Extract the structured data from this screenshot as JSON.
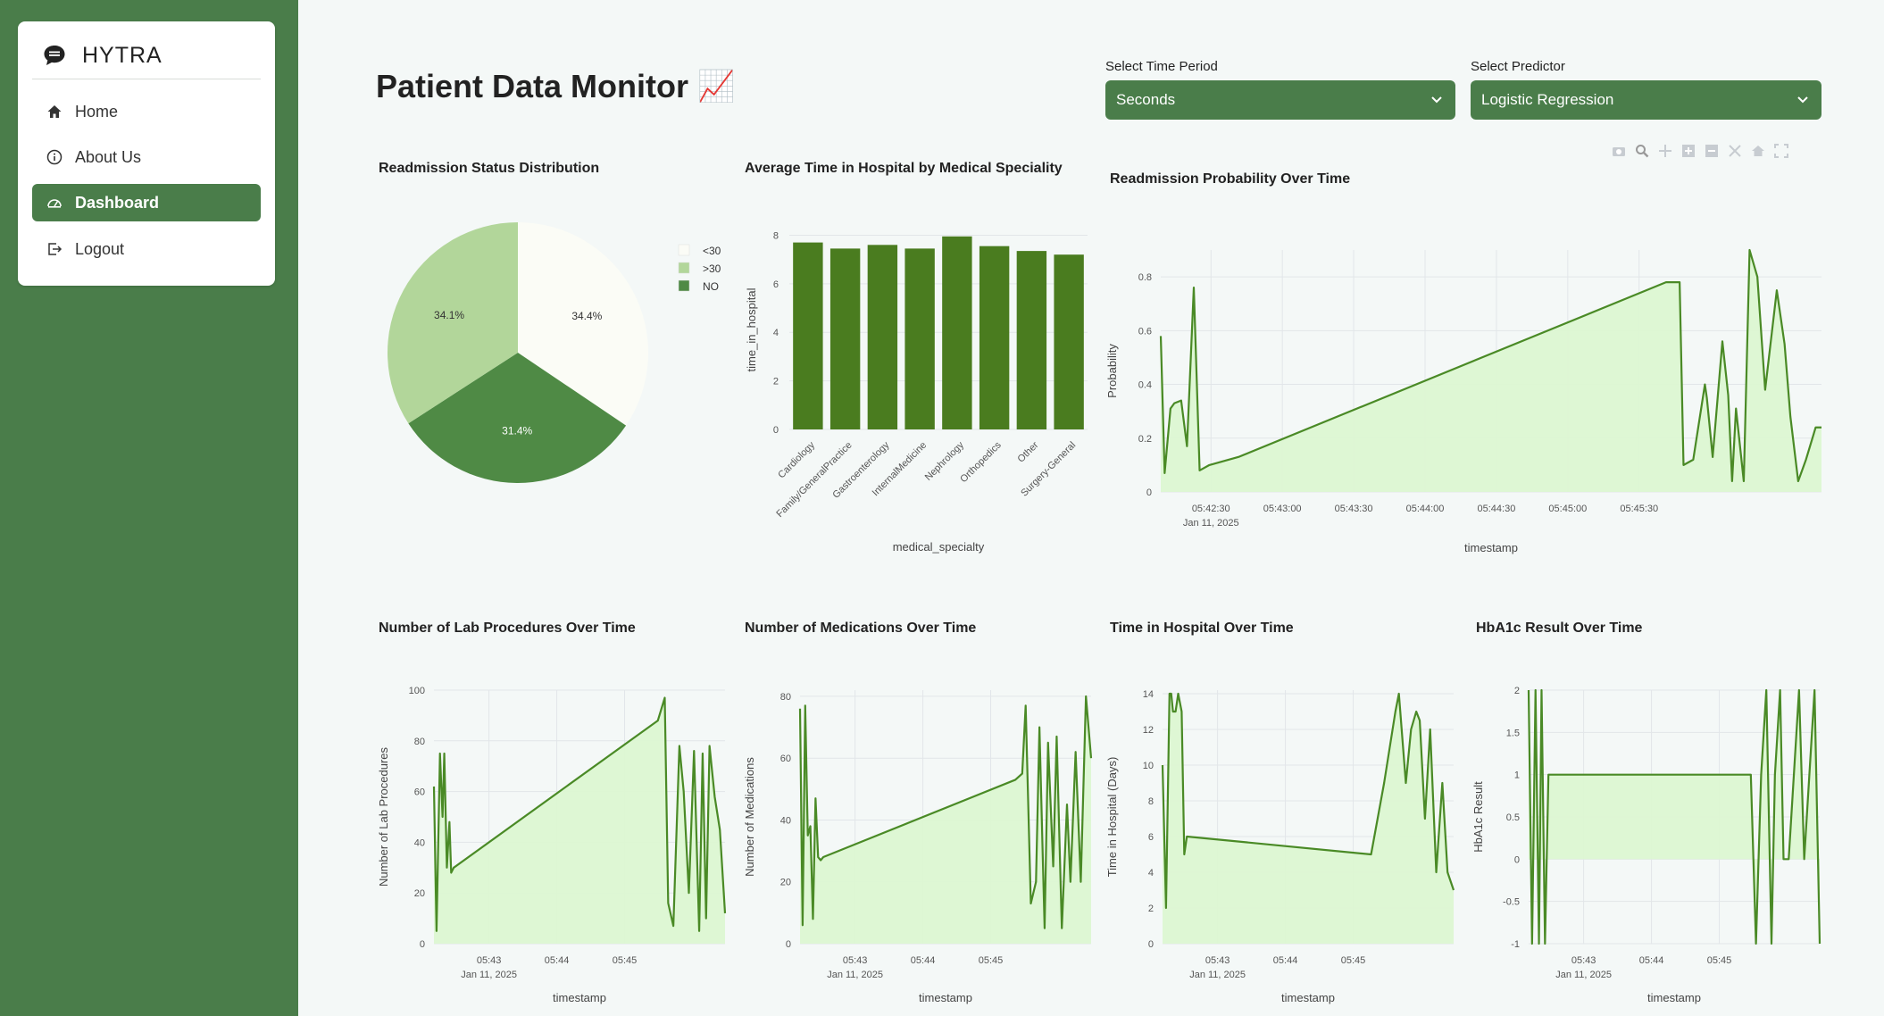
{
  "app": {
    "brand": "HYTRA"
  },
  "nav": {
    "items": [
      {
        "label": "Home",
        "icon": "home-icon"
      },
      {
        "label": "About Us",
        "icon": "info-icon"
      },
      {
        "label": "Dashboard",
        "icon": "dashboard-gauge-icon",
        "active": true
      },
      {
        "label": "Logout",
        "icon": "logout-icon"
      }
    ]
  },
  "page": {
    "title": "Patient Data Monitor",
    "title_emoji": "📈"
  },
  "controls": {
    "time_period": {
      "label": "Select Time Period",
      "value": "Seconds"
    },
    "predictor": {
      "label": "Select Predictor",
      "value": "Logistic Regression"
    }
  },
  "colors": {
    "accent": "#4a7d4a",
    "bar": "#4a7c1f",
    "line": "#4a8a26",
    "fill": "#dcf7d2",
    "pie_light": "#fbfcf6",
    "pie_mid": "#b2d69a",
    "pie_dark": "#4f8a45"
  },
  "modebar_icons": [
    "camera-icon",
    "zoom-icon",
    "pan-icon",
    "zoom-in-icon",
    "zoom-out-icon",
    "autoscale-icon",
    "reset-home-icon",
    "fullscreen-icon"
  ],
  "chart_data": [
    {
      "id": "pie",
      "type": "pie",
      "title": "Readmission Status Distribution",
      "legend": [
        "<30",
        ">30",
        "NO"
      ],
      "slices": [
        {
          "label": "<30",
          "value": 34.4,
          "text": "34.4%"
        },
        {
          "label": "NO",
          "value": 31.4,
          "text": "31.4%"
        },
        {
          "label": ">30",
          "value": 34.1,
          "text": "34.1%"
        }
      ],
      "legend_position": "right"
    },
    {
      "id": "bar",
      "type": "bar",
      "title": "Average Time in Hospital by Medical Speciality",
      "xlabel": "medical_specialty",
      "ylabel": "time_in_hospital",
      "categories": [
        "Cardiology",
        "Family/GeneralPractice",
        "Gastroenterology",
        "InternalMedicine",
        "Nephrology",
        "Orthopedics",
        "Other",
        "Surgery-General"
      ],
      "values": [
        7.7,
        7.45,
        7.6,
        7.45,
        7.95,
        7.55,
        7.35,
        7.2
      ],
      "ylim": [
        0,
        8.2
      ],
      "yticks": [
        "0",
        "2",
        "4",
        "6",
        "8"
      ]
    },
    {
      "id": "prob",
      "type": "area",
      "title": "Readmission Probability Over Time",
      "xlabel": "timestamp",
      "ylabel": "Probability",
      "xticks": [
        "05:42:30",
        "05:43:00",
        "05:43:30",
        "05:44:00",
        "05:44:30",
        "05:45:00",
        "05:45:30"
      ],
      "xsub": "Jan 11, 2025",
      "yticks": [
        "0",
        "0.2",
        "0.4",
        "0.6",
        "0.8"
      ],
      "ylim": [
        0,
        0.9
      ],
      "x": [
        0,
        0.04,
        0.1,
        0.14,
        0.21,
        0.27,
        0.34,
        0.4,
        0.5,
        0.8,
        5.2,
        5.34,
        5.38,
        5.48,
        5.6,
        5.62,
        5.68,
        5.78,
        5.84,
        5.88,
        5.92,
        6.0,
        6.06,
        6.14,
        6.22,
        6.34,
        6.42,
        6.48,
        6.56,
        6.64,
        6.74,
        6.8
      ],
      "y": [
        0.58,
        0.07,
        0.31,
        0.33,
        0.34,
        0.17,
        0.76,
        0.08,
        0.1,
        0.13,
        0.78,
        0.78,
        0.1,
        0.12,
        0.4,
        0.35,
        0.13,
        0.56,
        0.36,
        0.04,
        0.31,
        0.04,
        0.9,
        0.8,
        0.38,
        0.75,
        0.55,
        0.28,
        0.04,
        0.12,
        0.24,
        0.24
      ]
    },
    {
      "id": "lab",
      "type": "area",
      "title": "Number of Lab Procedures Over Time",
      "xlabel": "timestamp",
      "ylabel": "Number of Lab Procedures",
      "xticks": [
        "05:43",
        "05:44",
        "05:45"
      ],
      "xsub": "Jan 11, 2025",
      "yticks": [
        "0",
        "20",
        "40",
        "60",
        "80",
        "100"
      ],
      "ylim": [
        0,
        100
      ],
      "x": [
        0,
        0.03,
        0.07,
        0.1,
        0.12,
        0.15,
        0.18,
        0.2,
        0.23,
        2.6,
        2.68,
        2.72,
        2.78,
        2.85,
        2.9,
        2.96,
        3.02,
        3.08,
        3.12,
        3.16,
        3.2,
        3.26,
        3.32,
        3.38
      ],
      "y": [
        62,
        5,
        75,
        50,
        75,
        30,
        48,
        28,
        30,
        88,
        97,
        16,
        7,
        78,
        60,
        20,
        76,
        5,
        75,
        10,
        78,
        58,
        45,
        12
      ]
    },
    {
      "id": "meds",
      "type": "area",
      "title": "Number of Medications Over Time",
      "xlabel": "timestamp",
      "ylabel": "Number of Medications",
      "xticks": [
        "05:43",
        "05:44",
        "05:45"
      ],
      "xsub": "Jan 11, 2025",
      "yticks": [
        "0",
        "20",
        "40",
        "60",
        "80"
      ],
      "ylim": [
        0,
        82
      ],
      "x": [
        0,
        0.03,
        0.06,
        0.09,
        0.12,
        0.15,
        0.18,
        0.21,
        0.24,
        0.27,
        2.5,
        2.58,
        2.62,
        2.68,
        2.74,
        2.78,
        2.84,
        2.88,
        2.94,
        2.98,
        3.04,
        3.1,
        3.14,
        3.2,
        3.26,
        3.32,
        3.38
      ],
      "y": [
        76,
        6,
        77,
        35,
        38,
        8,
        47,
        28,
        27,
        28,
        53,
        55,
        77,
        13,
        20,
        70,
        5,
        65,
        25,
        67,
        5,
        45,
        20,
        62,
        20,
        80,
        60
      ]
    },
    {
      "id": "time",
      "type": "area",
      "title": "Time in Hospital Over Time",
      "xlabel": "timestamp",
      "ylabel": "Time in Hospital (Days)",
      "xticks": [
        "05:43",
        "05:44",
        "05:45"
      ],
      "xsub": "Jan 11, 2025",
      "yticks": [
        "0",
        "2",
        "4",
        "6",
        "8",
        "10",
        "12",
        "14"
      ],
      "ylim": [
        0,
        14.2
      ],
      "x": [
        0,
        0.04,
        0.08,
        0.1,
        0.12,
        0.15,
        0.18,
        0.22,
        0.25,
        0.28,
        2.4,
        2.55,
        2.68,
        2.72,
        2.8,
        2.86,
        2.92,
        2.96,
        3.02,
        3.08,
        3.15,
        3.22,
        3.28,
        3.35
      ],
      "y": [
        10,
        2,
        14,
        14,
        13,
        13,
        14,
        13,
        5,
        6,
        5,
        9,
        13,
        14,
        9,
        12,
        13,
        12.5,
        7,
        12,
        4,
        9,
        4,
        3
      ]
    },
    {
      "id": "hba1c",
      "type": "area",
      "title": "HbA1c Result Over Time",
      "xlabel": "timestamp",
      "ylabel": "HbA1c Result",
      "xticks": [
        "05:43",
        "05:44",
        "05:45"
      ],
      "xsub": "Jan 11, 2025",
      "yticks": [
        "-1",
        "-0.5",
        "0",
        "0.5",
        "1",
        "1.5",
        "2"
      ],
      "ylim": [
        -1,
        2
      ],
      "x": [
        0,
        0.04,
        0.08,
        0.12,
        0.15,
        0.19,
        0.23,
        2.58,
        2.64,
        2.7,
        2.76,
        2.82,
        2.86,
        2.92,
        2.96,
        3.02,
        3.08,
        3.14,
        3.2,
        3.26,
        3.32,
        3.38
      ],
      "y": [
        2,
        -1,
        2,
        -1,
        2,
        -1,
        1,
        1,
        -1,
        1,
        2,
        -1,
        1,
        2,
        0,
        0,
        1,
        2,
        0,
        1,
        2,
        -1
      ]
    }
  ]
}
